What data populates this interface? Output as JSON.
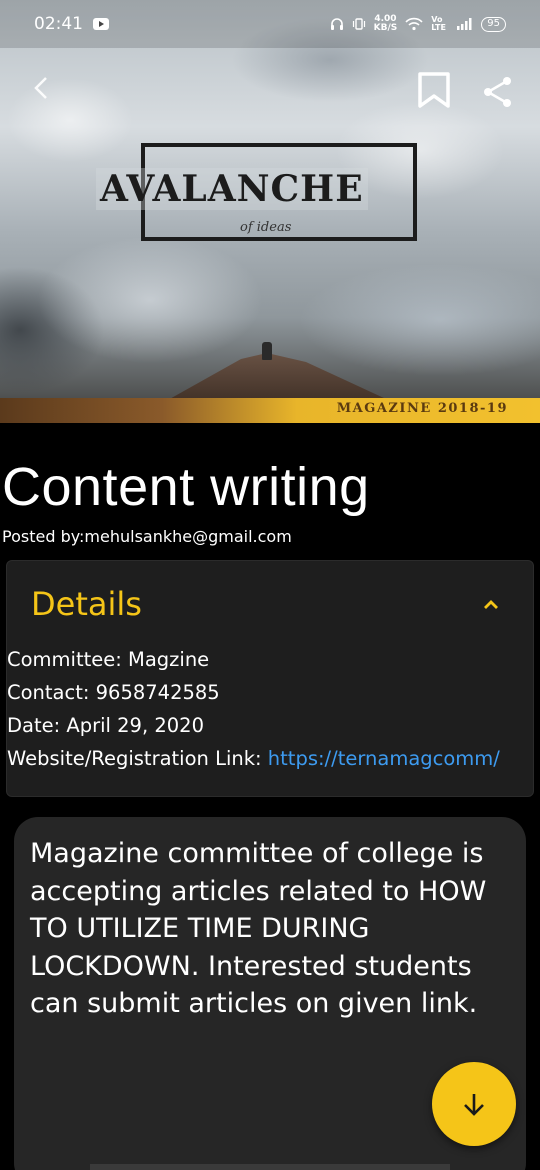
{
  "status_bar": {
    "time": "02:41",
    "net_speed_value": "4.00",
    "net_speed_unit": "KB/S",
    "network_label": "Vo LTE",
    "battery": "95"
  },
  "hero": {
    "logo_title": "AVALANCHE",
    "logo_subtitle": "of ideas",
    "band_label": "MAGAZINE 2018-19"
  },
  "post": {
    "title": "Content writing",
    "posted_by": "Posted by:mehulsankhe@gmail.com"
  },
  "details": {
    "heading": "Details",
    "committee": "Committee: Magzine",
    "contact": "Contact: 9658742585",
    "date": "Date: April 29, 2020",
    "website_label": "Website/Registration Link: ",
    "website_url": "https://ternamagcomm/"
  },
  "description": "Magazine committee of college is accepting articles related to HOW TO UTILIZE TIME DURING LOCKDOWN. Interested students can submit articles on given link.",
  "colors": {
    "accent": "#f5c518",
    "link": "#3d9bf0",
    "card": "#1e1e1e"
  }
}
